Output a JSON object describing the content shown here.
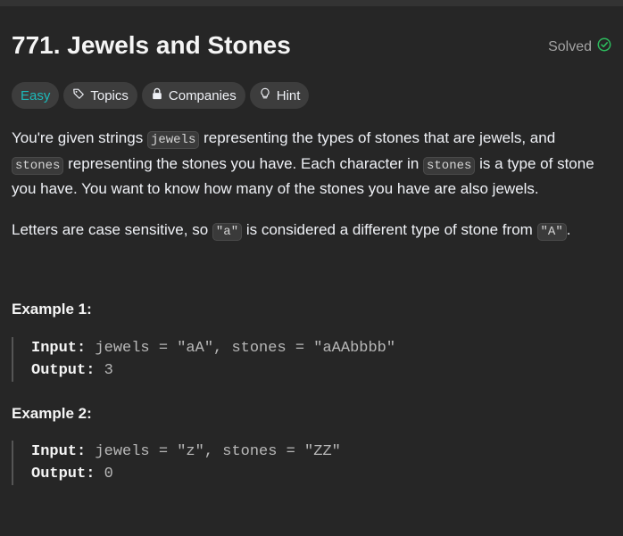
{
  "problem": {
    "title": "771. Jewels and Stones",
    "status": "Solved"
  },
  "chips": {
    "difficulty": "Easy",
    "topics": "Topics",
    "companies": "Companies",
    "hint": "Hint"
  },
  "description": {
    "p1_a": "You're given strings ",
    "p1_code1": "jewels",
    "p1_b": " representing the types of stones that are jewels, and ",
    "p1_code2": "stones",
    "p1_c": " representing the stones you have. Each character in ",
    "p1_code3": "stones",
    "p1_d": " is a type of stone you have. You want to know how many of the stones you have are also jewels.",
    "p2_a": "Letters are case sensitive, so ",
    "p2_code1": "\"a\"",
    "p2_b": " is considered a different type of stone from ",
    "p2_code2": "\"A\"",
    "p2_c": "."
  },
  "examples": [
    {
      "title": "Example 1:",
      "input_label": "Input:",
      "input_value": " jewels = \"aA\", stones = \"aAAbbbb\"",
      "output_label": "Output:",
      "output_value": " 3"
    },
    {
      "title": "Example 2:",
      "input_label": "Input:",
      "input_value": " jewels = \"z\", stones = \"ZZ\"",
      "output_label": "Output:",
      "output_value": " 0"
    }
  ],
  "colors": {
    "background": "#262626",
    "easy": "#1cbaba",
    "solved_check": "#2cbb5d"
  },
  "icons": {
    "solved": "check-circle-icon",
    "topics": "tag-icon",
    "companies": "lock-icon",
    "hint": "lightbulb-icon"
  }
}
